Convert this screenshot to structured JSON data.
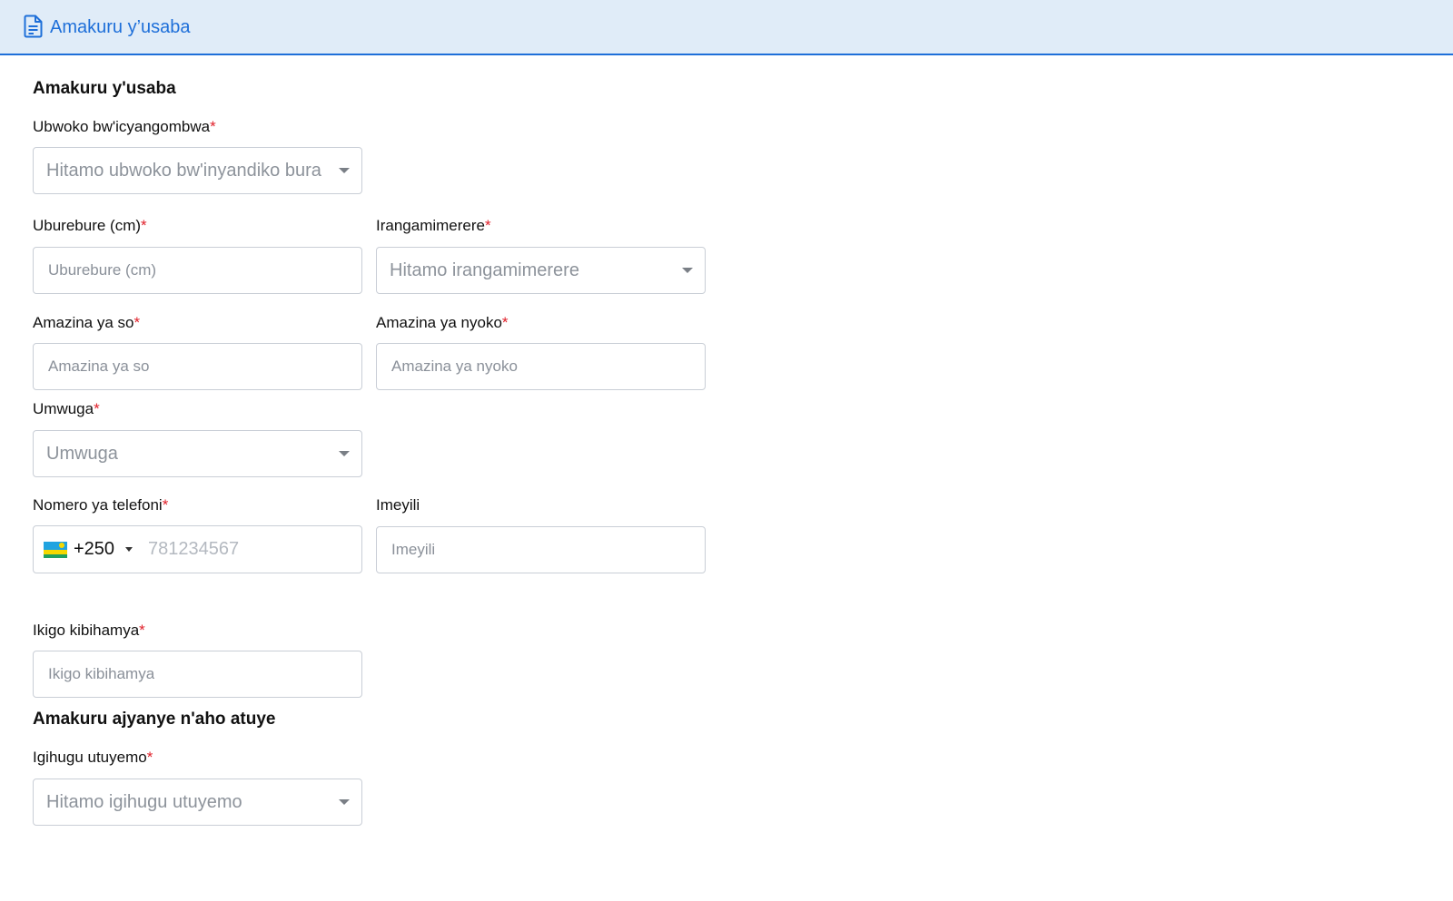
{
  "tab": {
    "title": "Amakuru y’usaba",
    "icon": "document-icon",
    "accent_color": "#1e6fd9"
  },
  "section_applicant": {
    "heading": "Amakuru y'usaba"
  },
  "fields": {
    "document_type": {
      "label": "Ubwoko bw'icyangombwa",
      "required": "*",
      "placeholder": "Hitamo ubwoko bw'inyandiko bura"
    },
    "height": {
      "label": "Uburebure (cm)",
      "required": "*",
      "placeholder": "Uburebure (cm)"
    },
    "eye_color": {
      "label": "Irangamimerere",
      "required": "*",
      "placeholder": "Hitamo irangamimerere"
    },
    "father_name": {
      "label": "Amazina ya so",
      "required": "*",
      "placeholder": "Amazina ya so"
    },
    "mother_name": {
      "label": "Amazina ya nyoko",
      "required": "*",
      "placeholder": "Amazina ya nyoko"
    },
    "profession": {
      "label": "Umwuga",
      "required": "*",
      "placeholder": "Umwuga"
    },
    "phone": {
      "label": "Nomero ya telefoni",
      "required": "*",
      "country_code": "+250",
      "flag_icon": "rwanda-flag-icon",
      "placeholder": "781234567"
    },
    "email": {
      "label": "Imeyili",
      "placeholder": "Imeyili"
    },
    "institution": {
      "label": "Ikigo kibihamya",
      "required": "*",
      "placeholder": "Ikigo kibihamya"
    },
    "country": {
      "label": "Igihugu utuyemo",
      "required": "*",
      "placeholder": "Hitamo igihugu utuyemo"
    }
  },
  "section_residence": {
    "heading": "Amakuru ajyanye n'aho atuye"
  },
  "colors": {
    "required_marker": "#e0202a",
    "header_background": "#e0ecf8",
    "field_border": "#c9ced6"
  }
}
